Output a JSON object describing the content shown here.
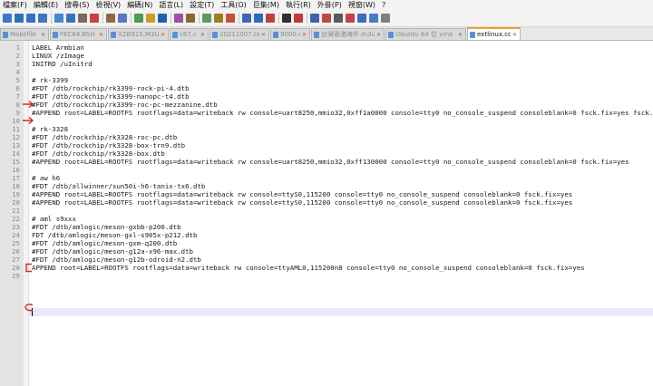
{
  "menu": [
    "檔案(F)",
    "編輯(E)",
    "搜尋(S)",
    "檢視(V)",
    "編碼(N)",
    "語言(L)",
    "設定(T)",
    "工具(O)",
    "巨集(M)",
    "執行(R)",
    "外掛(P)",
    "視窗(W)",
    "?"
  ],
  "toolbar": {
    "colors": [
      "#3e78c8",
      "#2f6fbf",
      "#3a6ec0",
      "#3c78c0",
      "#4488d0",
      "#3b72c0",
      "#7a6a5a",
      "#ca4040",
      "#8b6a4a",
      "#5a7ac0",
      "#4f9a4f",
      "#c8a028",
      "#2060b0",
      "#a050a0",
      "#8a6a2a",
      "#5a9a5a",
      "#a07a20",
      "#c85030",
      "#3f66b8",
      "#2d6bbf",
      "#c04040",
      "#303030",
      "#c03a3a",
      "#4060b0",
      "#c04848",
      "#5a5a5a",
      "#c84040",
      "#3c6ebf",
      "#4a7acc",
      "#808080"
    ]
  },
  "tabs": [
    {
      "label": "Makefile",
      "active": false
    },
    {
      "label": "FEC64.BSH",
      "active": false
    },
    {
      "label": "XZB915.M3U",
      "active": false
    },
    {
      "label": "c67.c",
      "active": false
    },
    {
      "label": "20211007.txt",
      "active": false
    },
    {
      "label": "9000.c",
      "active": false
    },
    {
      "label": "台灣香港海外.m3u",
      "active": false
    },
    {
      "label": "Ubuntu 64 位 vmx",
      "active": false
    },
    {
      "label": "extlinux.conf",
      "active": true
    }
  ],
  "lines": [
    "LABEL Armbian",
    "LINUX /zImage",
    "INITRD /uInitrd",
    "",
    "# rk-3399",
    "#FDT /dtb/rockchip/rk3399-rock-pi-4.dtb",
    "#FDT /dtb/rockchip/rk3399-nanopc-t4.dtb",
    "#FDT /dtb/rockchip/rk3399-roc-pc-mezzanine.dtb",
    "#APPEND root=LABEL=ROOTFS rootflags=data=writeback rw console=uart8250,mmio32,0xff1a0000 console=tty0 no_console_suspend consoleblank=0 fsck.fix=yes fsck.repair=yes",
    "",
    "# rk-3328",
    "#FDT /dtb/rockchip/rk3328-roc-pc.dtb",
    "#FDT /dtb/rockchip/rk3328-box-trn9.dtb",
    "#FDT /dtb/rockchip/rk3328-box.dtb",
    "#APPEND root=LABEL=ROOTFS rootflags=data=writeback rw console=uart8250,mmio32,0xff130000 console=tty0 no_console_suspend consoleblank=0 fsck.fix=yes",
    "",
    "# aw h6",
    "#FDT /dtb/allwinner/sun50i-h6-tanix-tx6.dtb",
    "#APPEND root=LABEL=ROOTFS rootflags=data=writeback rw console=ttyS0,115200 console=tty0 no_console_suspend consoleblank=0 fsck.fix=yes",
    "#APPEND root=LABEL=ROOTFS rootflags=data=writeback rw console=ttyS0,115200 console=tty0 no_console_suspend consoleblank=0 fsck.fix=yes",
    "",
    "# aml s9xxx",
    "#FDT /dtb/amlogic/meson-gxbb-p200.dtb",
    "FDT /dtb/amlogic/meson-gxl-s905x-p212.dtb",
    "#FDT /dtb/amlogic/meson-gxm-q200.dtb",
    "#FDT /dtb/amlogic/meson-g12a-x96-max.dtb",
    "#FDT /dtb/amlogic/meson-g12b-odroid-n2.dtb",
    "APPEND root=LABEL=ROOTFS rootflags=data=writeback rw console=ttyAML0,115200n8 console=tty0 no_console_suspend consoleblank=0 fsck.fix=yes",
    ""
  ],
  "line_numbers": [
    "1",
    "2",
    "3",
    "4",
    "5",
    "6",
    "7",
    "8",
    "9",
    "10",
    "11",
    "12",
    "13",
    "14",
    "15",
    "16",
    "17",
    "18",
    "19",
    "20",
    "21",
    "22",
    "23",
    "24",
    "25",
    "26",
    "27",
    "28",
    "29"
  ],
  "annotation_color": "#e02020"
}
